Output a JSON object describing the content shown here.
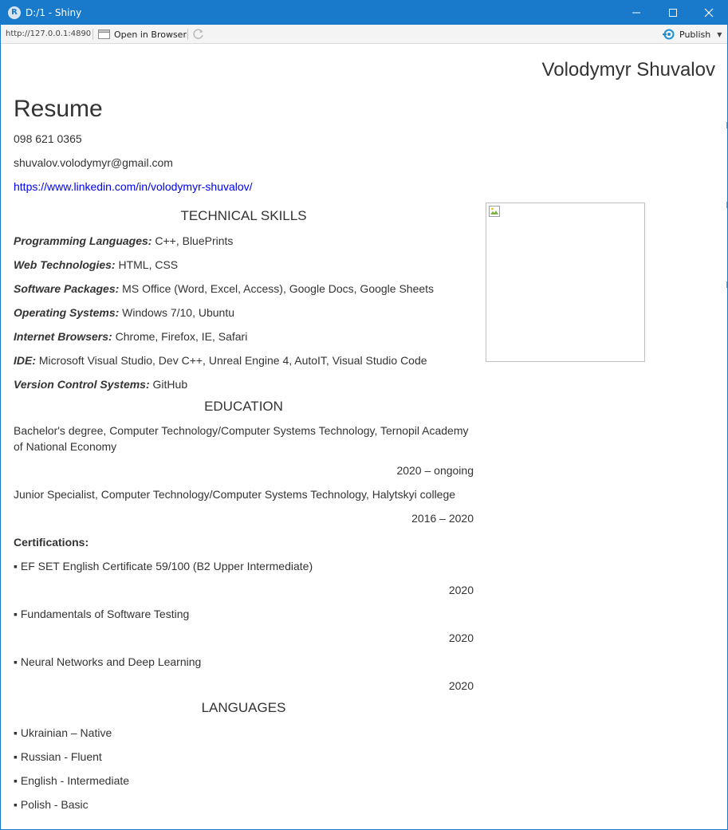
{
  "window": {
    "title": "D:/1 - Shiny",
    "app_icon_letter": "R",
    "accent_color": "#1979ca"
  },
  "toolbar": {
    "url": "http://127.0.0.1:4890",
    "open_in_browser": "Open in Browser",
    "publish": "Publish"
  },
  "resume": {
    "author": "Volodymyr Shuvalov",
    "heading": "Resume",
    "phone": "098 621 0365",
    "email": "shuvalov.volodymyr@gmail.com",
    "linkedin": "https://www.linkedin.com/in/volodymyr-shuvalov/",
    "sections": {
      "technical_skills": "TECHNICAL SKILLS",
      "education": "EDUCATION",
      "languages": "LANGUAGES"
    },
    "skills": [
      {
        "label": "Programming Languages:",
        "value": " C++, BluePrints"
      },
      {
        "label": "Web Technologies:",
        "value": " HTML, CSS"
      },
      {
        "label": "Software Packages:",
        "value": " MS Office (Word, Excel, Access), Google Docs, Google Sheets"
      },
      {
        "label": "Operating Systems:",
        "value": " Windows 7/10, Ubuntu"
      },
      {
        "label": "Internet Browsers:",
        "value": " Chrome, Firefox, IE, Safari"
      },
      {
        "label": "IDE:",
        "value": " Microsoft Visual Studio, Dev C++, Unreal Engine 4, AutoIT, Visual Studio Code"
      },
      {
        "label": "Version Control Systems:",
        "value": " GitHub"
      }
    ],
    "education": [
      {
        "text": "Bachelor's degree, Computer Technology/Computer Systems Technology, Ternopil Academy of National Economy",
        "period": "2020 – ongoing"
      },
      {
        "text": "Junior Specialist, Computer Technology/Computer Systems Technology, Halytskyi college",
        "period": "2016 – 2020"
      }
    ],
    "certifications_title": "Certifications:",
    "certifications": [
      {
        "text": "▪ EF SET English Certificate 59/100 (B2 Upper Intermediate)",
        "year": "2020"
      },
      {
        "text": "▪ Fundamentals of Software Testing",
        "year": "2020"
      },
      {
        "text": "▪ Neural Networks and Deep Learning",
        "year": "2020"
      }
    ],
    "languages": [
      "▪ Ukrainian – Native",
      "▪ Russian - Fluent",
      "▪ English - Intermediate",
      "▪ Polish - Basic"
    ]
  }
}
